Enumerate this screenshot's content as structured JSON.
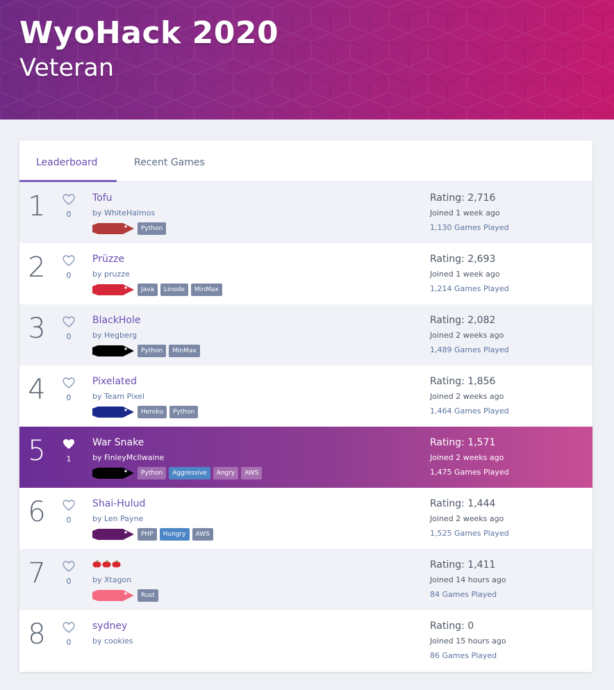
{
  "header": {
    "title": "WyoHack 2020",
    "subtitle": "Veteran"
  },
  "tabs": [
    {
      "label": "Leaderboard",
      "active": true
    },
    {
      "label": "Recent Games",
      "active": false
    }
  ],
  "leaderboard": [
    {
      "rank": "1",
      "hearts": "0",
      "liked": false,
      "name": "Tofu",
      "author": "by WhiteHalmos",
      "snake_color": "#b33a3a",
      "tags": [
        {
          "label": "Python",
          "style": "gray"
        }
      ],
      "rating": "Rating: 2,716",
      "joined": "Joined 1 week ago",
      "games": "1,130 Games Played"
    },
    {
      "rank": "2",
      "hearts": "0",
      "liked": false,
      "name": "Prüzze",
      "author": "by pruzze",
      "snake_color": "#d7283a",
      "tags": [
        {
          "label": "Java",
          "style": "gray"
        },
        {
          "label": "Linode",
          "style": "gray"
        },
        {
          "label": "MinMax",
          "style": "gray"
        }
      ],
      "rating": "Rating: 2,693",
      "joined": "Joined 1 week ago",
      "games": "1,214 Games Played"
    },
    {
      "rank": "3",
      "hearts": "0",
      "liked": false,
      "name": "BlackHole",
      "author": "by Hegberg",
      "snake_color": "#000000",
      "tags": [
        {
          "label": "Python",
          "style": "gray"
        },
        {
          "label": "MinMax",
          "style": "gray"
        }
      ],
      "rating": "Rating: 2,082",
      "joined": "Joined 2 weeks ago",
      "games": "1,489 Games Played"
    },
    {
      "rank": "4",
      "hearts": "0",
      "liked": false,
      "name": "Pixelated",
      "author": "by Team Pixel",
      "snake_color": "#1a2a8c",
      "tags": [
        {
          "label": "Heroku",
          "style": "gray"
        },
        {
          "label": "Python",
          "style": "gray"
        }
      ],
      "rating": "Rating: 1,856",
      "joined": "Joined 2 weeks ago",
      "games": "1,464 Games Played"
    },
    {
      "rank": "5",
      "hearts": "1",
      "liked": true,
      "name": "War Snake",
      "author": "by FinleyMcIlwaine",
      "snake_color": "#000000",
      "tags": [
        {
          "label": "Python",
          "style": "gray"
        },
        {
          "label": "Aggressive",
          "style": "blue"
        },
        {
          "label": "Angry",
          "style": "gray"
        },
        {
          "label": "AWS",
          "style": "gray"
        }
      ],
      "rating": "Rating: 1,571",
      "joined": "Joined 2 weeks ago",
      "games": "1,475 Games Played"
    },
    {
      "rank": "6",
      "hearts": "0",
      "liked": false,
      "name": "Shai-Hulud",
      "author": "by Len Payne",
      "snake_color": "#5e1a66",
      "tags": [
        {
          "label": "PHP",
          "style": "gray"
        },
        {
          "label": "Hungry",
          "style": "blue"
        },
        {
          "label": "AWS",
          "style": "gray"
        }
      ],
      "rating": "Rating: 1,444",
      "joined": "Joined 2 weeks ago",
      "games": "1,525 Games Played"
    },
    {
      "rank": "7",
      "hearts": "0",
      "liked": false,
      "name": "🍎🍎🍎",
      "author": "by Xtagon",
      "snake_color": "#f56a80",
      "tags": [
        {
          "label": "Rust",
          "style": "gray"
        }
      ],
      "rating": "Rating: 1,411",
      "joined": "Joined 14 hours ago",
      "games": "84 Games Played"
    },
    {
      "rank": "8",
      "hearts": "0",
      "liked": false,
      "name": "sydney",
      "author": "by cookies",
      "snake_color": "",
      "tags": [],
      "rating": "Rating: 0",
      "joined": "Joined 15 hours ago",
      "games": "86 Games Played"
    }
  ],
  "colors": {
    "accent": "#6a4db3",
    "highlight_start": "#6a2e97",
    "highlight_end": "#c84e95",
    "tag_gray": "#7a88a6",
    "tag_blue": "#4d86c6"
  },
  "icons": {
    "heart": "heart-icon",
    "snake": "snake-icon"
  }
}
